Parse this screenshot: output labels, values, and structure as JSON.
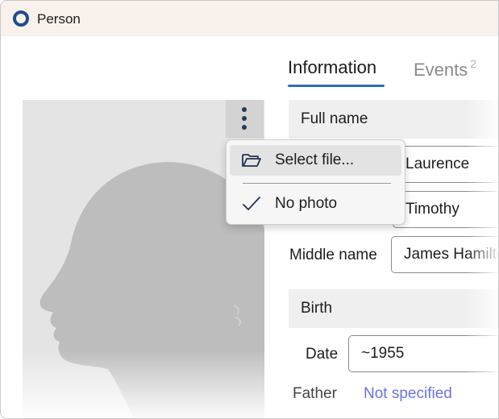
{
  "window": {
    "title": "Person",
    "app_icon": "app-ring-icon"
  },
  "tabs": [
    {
      "label": "Information",
      "active": true
    },
    {
      "label": "Events",
      "count": "2",
      "active": false
    }
  ],
  "photo": {
    "placeholder": "person-silhouette-icon",
    "menu_button_icon": "kebab-vertical-icon"
  },
  "photo_menu": {
    "items": [
      {
        "label": "Select file...",
        "icon": "folder-open-icon"
      },
      {
        "label": "No photo",
        "icon": "checkmark-icon",
        "checked": true
      }
    ]
  },
  "full_name": {
    "section_title": "Full name",
    "first_value": "Laurence",
    "second_value": "Timothy",
    "middle_label": "Middle name",
    "middle_value": "James Hamilton"
  },
  "birth": {
    "section_title": "Birth",
    "date_label": "Date",
    "date_value": "~1955",
    "father_label": "Father",
    "father_value": "Not specified"
  },
  "colors": {
    "titlebar": "#f8f1ec",
    "accent": "#2f6fb0",
    "link": "#6a73e0",
    "section_bg": "#efefef"
  }
}
